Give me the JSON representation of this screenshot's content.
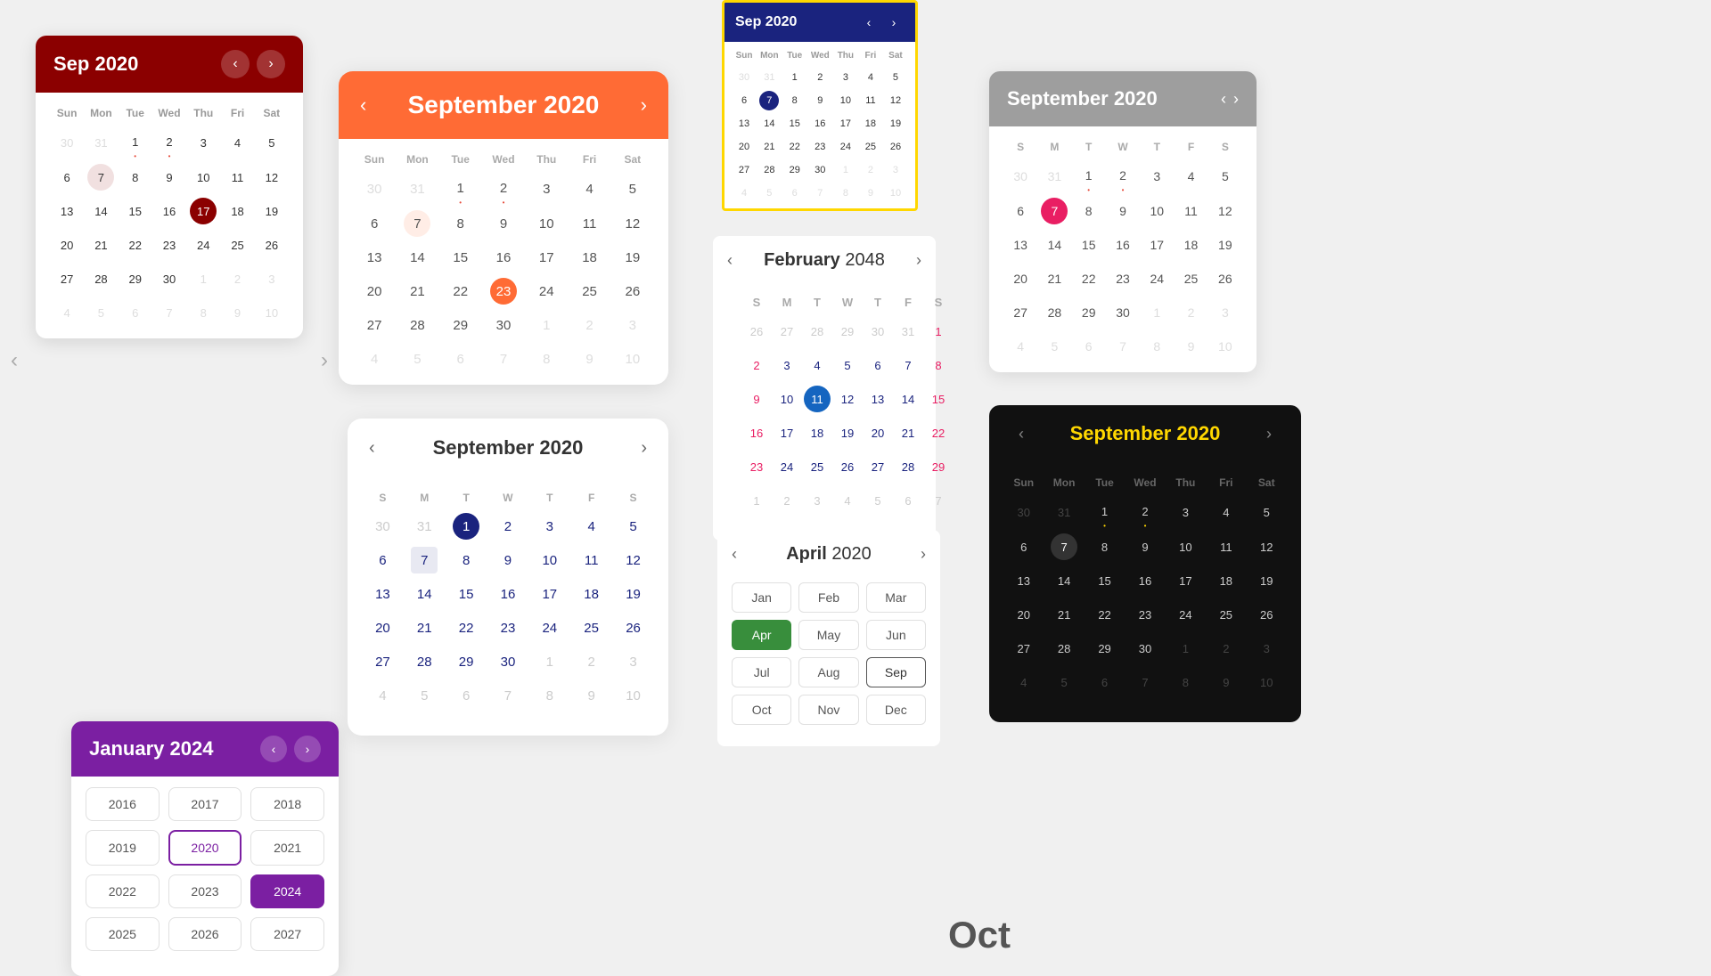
{
  "cal1": {
    "title": "Sep 2020",
    "header_bg": "#8B0000",
    "days": [
      "Sun",
      "Mon",
      "Tue",
      "Wed",
      "Thu",
      "Fri",
      "Sat"
    ],
    "weeks": [
      [
        {
          "d": "30",
          "other": true
        },
        {
          "d": "31",
          "other": true
        },
        {
          "d": "1",
          "dot": true
        },
        {
          "d": "2",
          "dot": true
        },
        {
          "d": "3"
        },
        {
          "d": "4"
        },
        {
          "d": "5"
        }
      ],
      [
        {
          "d": "6"
        },
        {
          "d": "7",
          "today": true
        },
        {
          "d": "8"
        },
        {
          "d": "9"
        },
        {
          "d": "10"
        },
        {
          "d": "11"
        },
        {
          "d": "12"
        }
      ],
      [
        {
          "d": "13"
        },
        {
          "d": "14"
        },
        {
          "d": "15"
        },
        {
          "d": "16"
        },
        {
          "d": "17",
          "selected": true
        },
        {
          "d": "18"
        },
        {
          "d": "19"
        }
      ],
      [
        {
          "d": "20"
        },
        {
          "d": "21"
        },
        {
          "d": "22"
        },
        {
          "d": "23"
        },
        {
          "d": "24"
        },
        {
          "d": "25"
        },
        {
          "d": "26"
        }
      ],
      [
        {
          "d": "27"
        },
        {
          "d": "28"
        },
        {
          "d": "29"
        },
        {
          "d": "30"
        },
        {
          "d": "1",
          "other": true
        },
        {
          "d": "2",
          "other": true
        },
        {
          "d": "3",
          "other": true
        }
      ],
      [
        {
          "d": "4",
          "other": true
        },
        {
          "d": "5",
          "other": true
        },
        {
          "d": "6",
          "other": true
        },
        {
          "d": "7",
          "other": true
        },
        {
          "d": "8",
          "other": true
        },
        {
          "d": "9",
          "other": true
        },
        {
          "d": "10",
          "other": true
        }
      ]
    ]
  },
  "cal2": {
    "title": "September 2020",
    "days": [
      "Sun",
      "Mon",
      "Tue",
      "Wed",
      "Thu",
      "Fri",
      "Sat"
    ],
    "weeks": [
      [
        {
          "d": "30",
          "other": true
        },
        {
          "d": "31",
          "other": true
        },
        {
          "d": "1",
          "dot": true
        },
        {
          "d": "2",
          "dot": true
        },
        {
          "d": "3"
        },
        {
          "d": "4"
        },
        {
          "d": "5"
        }
      ],
      [
        {
          "d": "6"
        },
        {
          "d": "7",
          "today": true
        },
        {
          "d": "8"
        },
        {
          "d": "9"
        },
        {
          "d": "10"
        },
        {
          "d": "11"
        },
        {
          "d": "12"
        }
      ],
      [
        {
          "d": "13"
        },
        {
          "d": "14"
        },
        {
          "d": "15"
        },
        {
          "d": "16"
        },
        {
          "d": "17"
        },
        {
          "d": "18"
        },
        {
          "d": "19"
        }
      ],
      [
        {
          "d": "20"
        },
        {
          "d": "21"
        },
        {
          "d": "22"
        },
        {
          "d": "23",
          "selected": true
        },
        {
          "d": "24"
        },
        {
          "d": "25"
        },
        {
          "d": "26"
        }
      ],
      [
        {
          "d": "27"
        },
        {
          "d": "28"
        },
        {
          "d": "29"
        },
        {
          "d": "30"
        },
        {
          "d": "1",
          "other": true
        },
        {
          "d": "2",
          "other": true
        },
        {
          "d": "3",
          "other": true
        }
      ],
      [
        {
          "d": "4",
          "other": true
        },
        {
          "d": "5",
          "other": true
        },
        {
          "d": "6",
          "other": true
        },
        {
          "d": "7",
          "other": true
        },
        {
          "d": "8",
          "other": true
        },
        {
          "d": "9",
          "other": true
        },
        {
          "d": "10",
          "other": true
        }
      ]
    ]
  },
  "cal3": {
    "title": "Sep 2020",
    "days": [
      "Sun",
      "Mon",
      "Tue",
      "Wed",
      "Thu",
      "Fri",
      "Sat"
    ],
    "weeks": [
      [
        {
          "d": "30",
          "other": true
        },
        {
          "d": "31",
          "other": true
        },
        {
          "d": "1"
        },
        {
          "d": "2"
        },
        {
          "d": "3"
        },
        {
          "d": "4"
        },
        {
          "d": "5"
        }
      ],
      [
        {
          "d": "6"
        },
        {
          "d": "7",
          "selected": true
        },
        {
          "d": "8"
        },
        {
          "d": "9"
        },
        {
          "d": "10"
        },
        {
          "d": "11"
        },
        {
          "d": "12"
        }
      ],
      [
        {
          "d": "13"
        },
        {
          "d": "14"
        },
        {
          "d": "15"
        },
        {
          "d": "16"
        },
        {
          "d": "17"
        },
        {
          "d": "18"
        },
        {
          "d": "19"
        }
      ],
      [
        {
          "d": "20"
        },
        {
          "d": "21"
        },
        {
          "d": "22"
        },
        {
          "d": "23"
        },
        {
          "d": "24"
        },
        {
          "d": "25"
        },
        {
          "d": "26"
        }
      ],
      [
        {
          "d": "27"
        },
        {
          "d": "28"
        },
        {
          "d": "29"
        },
        {
          "d": "30"
        },
        {
          "d": "1",
          "other": true
        },
        {
          "d": "2",
          "other": true
        },
        {
          "d": "3",
          "other": true
        }
      ],
      [
        {
          "d": "4",
          "other": true
        },
        {
          "d": "5",
          "other": true
        },
        {
          "d": "6",
          "other": true
        },
        {
          "d": "7",
          "other": true
        },
        {
          "d": "8",
          "other": true
        },
        {
          "d": "9",
          "other": true
        },
        {
          "d": "10",
          "other": true
        }
      ]
    ]
  },
  "cal4": {
    "title": "September 2020",
    "days": [
      "S",
      "M",
      "T",
      "W",
      "T",
      "F",
      "S"
    ],
    "weeks": [
      [
        {
          "d": "30",
          "other": true
        },
        {
          "d": "31",
          "other": true
        },
        {
          "d": "1",
          "dot": true
        },
        {
          "d": "2",
          "dot": true
        },
        {
          "d": "3"
        },
        {
          "d": "4"
        },
        {
          "d": "5"
        }
      ],
      [
        {
          "d": "6"
        },
        {
          "d": "7",
          "selected": true
        },
        {
          "d": "8"
        },
        {
          "d": "9"
        },
        {
          "d": "10"
        },
        {
          "d": "11"
        },
        {
          "d": "12"
        }
      ],
      [
        {
          "d": "13"
        },
        {
          "d": "14"
        },
        {
          "d": "15"
        },
        {
          "d": "16"
        },
        {
          "d": "17"
        },
        {
          "d": "18"
        },
        {
          "d": "19"
        }
      ],
      [
        {
          "d": "20"
        },
        {
          "d": "21"
        },
        {
          "d": "22"
        },
        {
          "d": "23"
        },
        {
          "d": "24"
        },
        {
          "d": "25"
        },
        {
          "d": "26"
        }
      ],
      [
        {
          "d": "27"
        },
        {
          "d": "28"
        },
        {
          "d": "29"
        },
        {
          "d": "30"
        },
        {
          "d": "1",
          "other": true
        },
        {
          "d": "2",
          "other": true
        },
        {
          "d": "3",
          "other": true
        }
      ],
      [
        {
          "d": "4",
          "other": true
        },
        {
          "d": "5",
          "other": true
        },
        {
          "d": "6",
          "other": true
        },
        {
          "d": "7",
          "other": true
        },
        {
          "d": "8",
          "other": true
        },
        {
          "d": "9",
          "other": true
        },
        {
          "d": "10",
          "other": true
        }
      ]
    ]
  },
  "cal5": {
    "title": "January 2024",
    "years": [
      {
        "y": "2016"
      },
      {
        "y": "2017"
      },
      {
        "y": "2018"
      },
      {
        "y": "2019"
      },
      {
        "y": "2020",
        "outline": true
      },
      {
        "y": "2021"
      },
      {
        "y": "2022"
      },
      {
        "y": "2023"
      },
      {
        "y": "2024",
        "active": true
      },
      {
        "y": "2025"
      },
      {
        "y": "2026"
      },
      {
        "y": "2027"
      }
    ]
  },
  "cal6": {
    "title": "September 2020",
    "days": [
      "S",
      "M",
      "T",
      "W",
      "T",
      "F",
      "S"
    ],
    "weeks": [
      [
        {
          "d": "30",
          "other": true
        },
        {
          "d": "31",
          "other": true
        },
        {
          "d": "1",
          "selected": true
        },
        {
          "d": "2"
        },
        {
          "d": "3"
        },
        {
          "d": "4"
        },
        {
          "d": "5"
        }
      ],
      [
        {
          "d": "6"
        },
        {
          "d": "7",
          "today": true
        },
        {
          "d": "8"
        },
        {
          "d": "9"
        },
        {
          "d": "10"
        },
        {
          "d": "11"
        },
        {
          "d": "12"
        }
      ],
      [
        {
          "d": "13"
        },
        {
          "d": "14"
        },
        {
          "d": "15"
        },
        {
          "d": "16"
        },
        {
          "d": "17"
        },
        {
          "d": "18"
        },
        {
          "d": "19"
        }
      ],
      [
        {
          "d": "20"
        },
        {
          "d": "21"
        },
        {
          "d": "22"
        },
        {
          "d": "23"
        },
        {
          "d": "24"
        },
        {
          "d": "25"
        },
        {
          "d": "26"
        }
      ],
      [
        {
          "d": "27"
        },
        {
          "d": "28"
        },
        {
          "d": "29"
        },
        {
          "d": "30"
        },
        {
          "d": "1",
          "other": true
        },
        {
          "d": "2",
          "other": true
        },
        {
          "d": "3",
          "other": true
        }
      ],
      [
        {
          "d": "4",
          "other": true
        },
        {
          "d": "5",
          "other": true
        },
        {
          "d": "6",
          "other": true
        },
        {
          "d": "7",
          "other": true
        },
        {
          "d": "8",
          "other": true
        },
        {
          "d": "9",
          "other": true
        },
        {
          "d": "10",
          "other": true
        }
      ]
    ]
  },
  "cal7": {
    "title_month": "February",
    "title_year": "2048",
    "days": [
      "S",
      "M",
      "T",
      "W",
      "T",
      "F",
      "S"
    ],
    "weeks": [
      [
        {
          "d": "26",
          "other": true
        },
        {
          "d": "27",
          "other": true
        },
        {
          "d": "28",
          "other": true
        },
        {
          "d": "29",
          "other": true
        },
        {
          "d": "30",
          "other": true
        },
        {
          "d": "31",
          "other": true
        },
        {
          "d": "1",
          "weekend": true
        }
      ],
      [
        {
          "d": "2",
          "weekend": true
        },
        {
          "d": "3"
        },
        {
          "d": "4"
        },
        {
          "d": "5"
        },
        {
          "d": "6"
        },
        {
          "d": "7"
        },
        {
          "d": "8",
          "weekend": true
        }
      ],
      [
        {
          "d": "9",
          "weekend": true
        },
        {
          "d": "10"
        },
        {
          "d": "11",
          "selected": true
        },
        {
          "d": "12"
        },
        {
          "d": "13"
        },
        {
          "d": "14"
        },
        {
          "d": "15",
          "weekend": true
        }
      ],
      [
        {
          "d": "16",
          "weekend": true
        },
        {
          "d": "17"
        },
        {
          "d": "18"
        },
        {
          "d": "19"
        },
        {
          "d": "20"
        },
        {
          "d": "21"
        },
        {
          "d": "22",
          "weekend": true
        }
      ],
      [
        {
          "d": "23",
          "weekend": true
        },
        {
          "d": "24"
        },
        {
          "d": "25"
        },
        {
          "d": "26"
        },
        {
          "d": "27"
        },
        {
          "d": "28"
        },
        {
          "d": "29",
          "weekend": true
        }
      ],
      [
        {
          "d": "1",
          "other": true,
          "weekend": true
        },
        {
          "d": "2",
          "other": true
        },
        {
          "d": "3",
          "other": true
        },
        {
          "d": "4",
          "other": true
        },
        {
          "d": "5",
          "other": true
        },
        {
          "d": "6",
          "other": true
        },
        {
          "d": "7",
          "other": true,
          "weekend": true
        }
      ]
    ]
  },
  "cal8": {
    "title_month": "April",
    "title_year": "2020",
    "months": [
      {
        "m": "Jan"
      },
      {
        "m": "Feb"
      },
      {
        "m": "Mar"
      },
      {
        "m": "Apr",
        "active": true
      },
      {
        "m": "May"
      },
      {
        "m": "Jun"
      },
      {
        "m": "Jul"
      },
      {
        "m": "Aug"
      },
      {
        "m": "Sep",
        "outline": true
      },
      {
        "m": "Oct"
      },
      {
        "m": "Nov"
      },
      {
        "m": "Dec"
      }
    ]
  },
  "cal9": {
    "title": "September 2020",
    "days": [
      "Sun",
      "Mon",
      "Tue",
      "Wed",
      "Thu",
      "Fri",
      "Sat"
    ],
    "weeks": [
      [
        {
          "d": "30",
          "other": true
        },
        {
          "d": "31",
          "other": true
        },
        {
          "d": "1",
          "dot": true
        },
        {
          "d": "2",
          "dot": true
        },
        {
          "d": "3"
        },
        {
          "d": "4"
        },
        {
          "d": "5"
        }
      ],
      [
        {
          "d": "6"
        },
        {
          "d": "7",
          "selected": true
        },
        {
          "d": "8"
        },
        {
          "d": "9"
        },
        {
          "d": "10"
        },
        {
          "d": "11"
        },
        {
          "d": "12"
        }
      ],
      [
        {
          "d": "13"
        },
        {
          "d": "14"
        },
        {
          "d": "15"
        },
        {
          "d": "16"
        },
        {
          "d": "17"
        },
        {
          "d": "18"
        },
        {
          "d": "19"
        }
      ],
      [
        {
          "d": "20"
        },
        {
          "d": "21"
        },
        {
          "d": "22"
        },
        {
          "d": "23"
        },
        {
          "d": "24"
        },
        {
          "d": "25"
        },
        {
          "d": "26"
        }
      ],
      [
        {
          "d": "27"
        },
        {
          "d": "28"
        },
        {
          "d": "29"
        },
        {
          "d": "30"
        },
        {
          "d": "1",
          "other": true
        },
        {
          "d": "2",
          "other": true
        },
        {
          "d": "3",
          "other": true
        }
      ],
      [
        {
          "d": "4",
          "other": true
        },
        {
          "d": "5",
          "other": true
        },
        {
          "d": "6",
          "other": true
        },
        {
          "d": "7",
          "other": true
        },
        {
          "d": "8",
          "other": true
        },
        {
          "d": "9",
          "other": true
        },
        {
          "d": "10",
          "other": true
        }
      ]
    ]
  },
  "bottom_label": "Oct"
}
